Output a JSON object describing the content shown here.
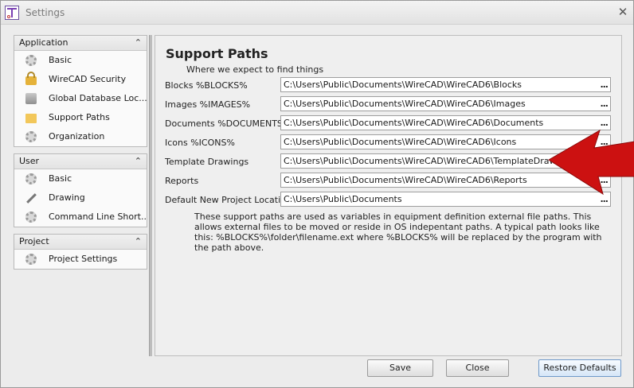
{
  "window": {
    "title": "Settings"
  },
  "nav": {
    "groups": [
      {
        "title": "Application",
        "items": [
          {
            "label": "Basic",
            "icon": "gear-icon"
          },
          {
            "label": "WireCAD Security",
            "icon": "lock-icon"
          },
          {
            "label": "Global Database Loc...",
            "icon": "database-icon"
          },
          {
            "label": "Support Paths",
            "icon": "folder-icon"
          },
          {
            "label": "Organization",
            "icon": "gear-icon"
          }
        ]
      },
      {
        "title": "User",
        "items": [
          {
            "label": "Basic",
            "icon": "gear-icon"
          },
          {
            "label": "Drawing",
            "icon": "wrench-icon"
          },
          {
            "label": "Command Line Short...",
            "icon": "gear-icon"
          }
        ]
      },
      {
        "title": "Project",
        "items": [
          {
            "label": "Project Settings",
            "icon": "gear-icon"
          }
        ]
      }
    ],
    "collapse_glyph": "⌃"
  },
  "panel": {
    "title": "Support Paths",
    "subtitle": "Where we expect to find things",
    "rows": [
      {
        "label": "Blocks %BLOCKS%",
        "value": "C:\\Users\\Public\\Documents\\WireCAD\\WireCAD6\\Blocks"
      },
      {
        "label": "Images %IMAGES%",
        "value": "C:\\Users\\Public\\Documents\\WireCAD\\WireCAD6\\Images"
      },
      {
        "label": "Documents %DOCUMENTS%",
        "value": "C:\\Users\\Public\\Documents\\WireCAD\\WireCAD6\\Documents"
      },
      {
        "label": "Icons %ICONS%",
        "value": "C:\\Users\\Public\\Documents\\WireCAD\\WireCAD6\\Icons"
      },
      {
        "label": "Template Drawings",
        "value": "C:\\Users\\Public\\Documents\\WireCAD\\WireCAD6\\TemplateDrawings"
      },
      {
        "label": "Reports",
        "value": "C:\\Users\\Public\\Documents\\WireCAD\\WireCAD6\\Reports"
      },
      {
        "label": "Default New Project Location",
        "value": "C:\\Users\\Public\\Documents"
      }
    ],
    "browse_label": "...",
    "note": "These support paths are used as variables in equipment definition external file paths. This allows external files to be moved or reside in OS indepentant paths. A typical path looks like this: %BLOCKS%\\folder\\filename.ext where %BLOCKS% will be replaced by the program with the path above."
  },
  "buttons": {
    "save": "Save",
    "close": "Close",
    "restore": "Restore Defaults"
  },
  "colors": {
    "arrow": "#cc1111",
    "accent": "#6f99c9"
  }
}
